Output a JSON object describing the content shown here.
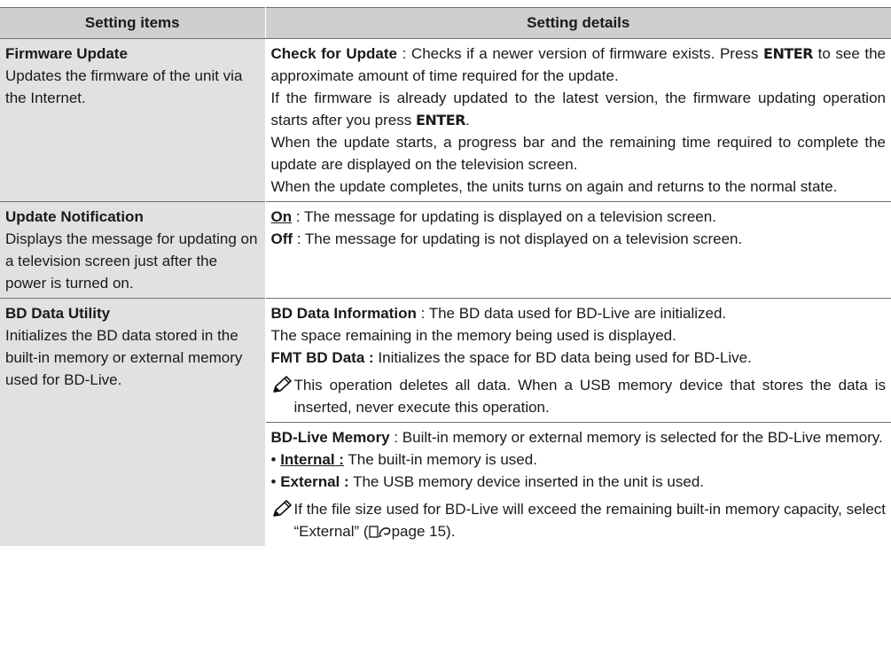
{
  "header": {
    "col1": "Setting items",
    "col2": "Setting details"
  },
  "firmware": {
    "title": "Firmware Update",
    "desc": "Updates the firmware of the unit via the Internet.",
    "check_label": "Check for Update",
    "check_text_1": " : Checks if a newer version of firmware exists. Press ",
    "enter": "ENTER",
    "check_text_2": " to see the approximate amount of time required for the update.",
    "already_text": "If the firmware is already updated to the latest version, the firmware updating operation starts after you press ",
    "period": ".",
    "progress_text": "When the update starts, a progress bar and the remaining time required to complete the update are displayed on the television screen.",
    "completes_text": "When the update completes, the units turns on again and returns to the normal state."
  },
  "notification": {
    "title": "Update Notification",
    "desc": "Displays the message for updating on a television screen just after the power is turned on.",
    "on_label": "On",
    "on_text": " : The message for updating is displayed on a television screen.",
    "off_label": "Off",
    "off_text": " : The message for updating is not displayed on a television screen."
  },
  "bd_utility": {
    "title": "BD Data Utility",
    "desc": "Initializes the BD data stored in the built-in memory or external memory used for BD-Live.",
    "info_label": "BD Data Information",
    "info_text": " : The BD data used for BD-Live are initialized.",
    "space_text": "The space remaining in the memory being used is displayed.",
    "fmt_label": "FMT BD Data :",
    "fmt_text": " Initializes the space for BD data being used for BD-Live.",
    "note_1": "This operation deletes all data. When a USB memory device that stores the data is inserted, never execute this operation.",
    "memory_label": "BD-Live Memory",
    "memory_text": " : Built-in memory or external memory is selected for the BD-Live memory.",
    "bullet": "• ",
    "internal_label": "Internal :",
    "internal_text": " The built-in memory is used.",
    "external_label": "External :",
    "external_text": " The USB memory device inserted in the unit is used.",
    "note_2_text": "If the file size used for BD-Live will exceed the remaining built-in memory capacity, select “External” (",
    "note_2_page": "page 15",
    "note_2_close": ")."
  },
  "icons": [
    "pencil-note-icon",
    "page-reference-icon"
  ]
}
